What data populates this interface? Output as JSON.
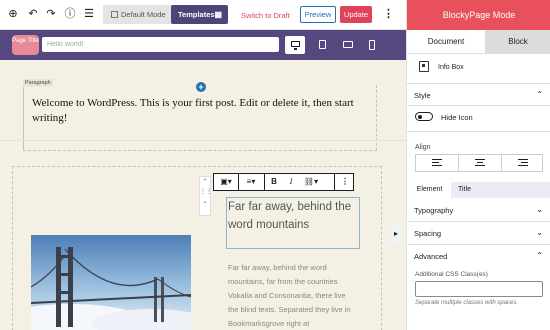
{
  "toolbar": {
    "add_icon": "plus-circle-icon",
    "undo_icon": "undo-icon",
    "redo_icon": "redo-icon",
    "info_icon": "info-icon",
    "outline_icon": "list-view-icon",
    "default_mode_label": "Default Mode",
    "templates_label": "Templates",
    "switch_to_draft": "Switch to Draft",
    "preview_label": "Preview",
    "update_label": "Update",
    "more_icon": "kebab-menu-icon"
  },
  "title_bar": {
    "pill_label": "Page Title",
    "placeholder": "Hello world!",
    "devices": [
      "desktop-icon",
      "tablet-icon",
      "tablet-landscape-icon",
      "mobile-icon"
    ]
  },
  "canvas": {
    "paragraph_tag": "Paragraph",
    "paragraph_text": "Welcome to WordPress. This is your first post. Edit or delete it, then start writing!",
    "heading_text": "Far far away, behind the word mountains",
    "description_text": "Far far away, behind the word mountains, far from the countries Vokalia and Consonantia, there live the blind texts. Separated they live in Bookmarksgrove right at",
    "block_toolbar": {
      "bold": "B",
      "italic": "I"
    }
  },
  "sidebar": {
    "header": "BlockyPage Mode",
    "tabs": [
      "Document",
      "Block"
    ],
    "block_name": "Info Box",
    "sections": {
      "style": "Style",
      "hide_icon": "Hide Icon",
      "align": "Align",
      "element_tab": "Element",
      "title_tab": "Title",
      "typography": "Typography",
      "spacing": "Spacing",
      "advanced": "Advanced",
      "css_label": "Additional CSS Class(es)",
      "css_help": "Separate multiple classes with spaces."
    }
  },
  "colors": {
    "accent": "#e8505b",
    "purple": "#56477f",
    "canvas": "#f4f0e3"
  }
}
